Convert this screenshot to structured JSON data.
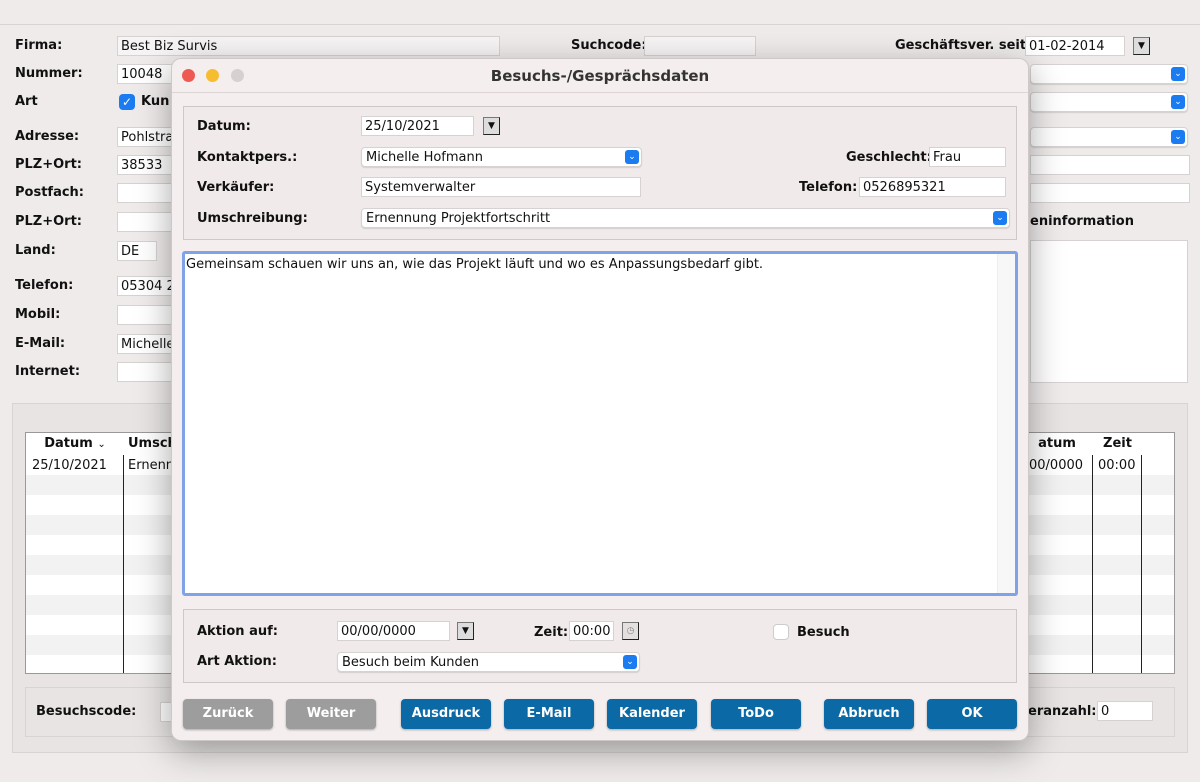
{
  "background_form": {
    "firma_label": "Firma:",
    "firma_value": "Best Biz Survis",
    "nummer_label": "Nummer:",
    "nummer_value": "10048",
    "art_label": "Art",
    "art_checkbox_label": "Kun",
    "art_checked": true,
    "adresse_label": "Adresse:",
    "adresse_value": "Pohlstra",
    "plz_ort_label": "PLZ+Ort:",
    "plz_value": "38533",
    "postfach_label": "Postfach:",
    "plz_ort2_label": "PLZ+Ort:",
    "land_label": "Land:",
    "land_value": "DE",
    "telefon_label": "Telefon:",
    "telefon_value": "05304 2",
    "mobil_label": "Mobil:",
    "email_label": "E-Mail:",
    "email_value": "Michelle",
    "internet_label": "Internet:",
    "suchcode_label": "Suchcode:",
    "geschaeftsver_label": "Geschäftsver. seit:",
    "geschaeftsver_value": "01-02-2014",
    "info_label": "eninformation"
  },
  "table": {
    "columns": [
      "Datum",
      "Umsch",
      "atum",
      "Zeit"
    ],
    "rows": [
      [
        "25/10/2021",
        "Ernenn",
        "00/0000",
        "00:00"
      ]
    ]
  },
  "bottom_bar": {
    "besuchscode_label": "Besuchscode:",
    "anzahl_label": "eranzahl:",
    "anzahl_value": "0"
  },
  "dialog": {
    "title": "Besuchs-/Gesprächsdaten",
    "datum_label": "Datum:",
    "datum_value": "25/10/2021",
    "kontakt_label": "Kontaktpers.:",
    "kontakt_value": "Michelle Hofmann",
    "geschlecht_label": "Geschlecht:",
    "geschlecht_value": "Frau",
    "verkaeufer_label": "Verkäufer:",
    "verkaeufer_value": "Systemverwalter",
    "telefon_label": "Telefon:",
    "telefon_value": "0526895321",
    "umschreibung_label": "Umschreibung:",
    "umschreibung_value": "Ernennung Projektfortschritt",
    "notes": "Gemeinsam schauen wir uns an, wie das Projekt läuft und wo es Anpassungsbedarf gibt.",
    "aktion_label": "Aktion auf:",
    "aktion_value": "00/00/0000",
    "zeit_label": "Zeit:",
    "zeit_value": "00:00",
    "besuch_label": "Besuch",
    "besuch_checked": false,
    "art_aktion_label": "Art Aktion:",
    "art_aktion_value": "Besuch beim Kunden",
    "buttons": {
      "zurueck": "Zurück",
      "weiter": "Weiter",
      "ausdruck": "Ausdruck",
      "email": "E-Mail",
      "kalender": "Kalender",
      "todo": "ToDo",
      "abbruch": "Abbruch",
      "ok": "OK"
    }
  },
  "colors": {
    "accent": "#0b6aa6",
    "disabled": "#9d9d9d",
    "focus": "#7fa3e6",
    "close": "#ee5a52",
    "minimize": "#f5bd2f"
  }
}
